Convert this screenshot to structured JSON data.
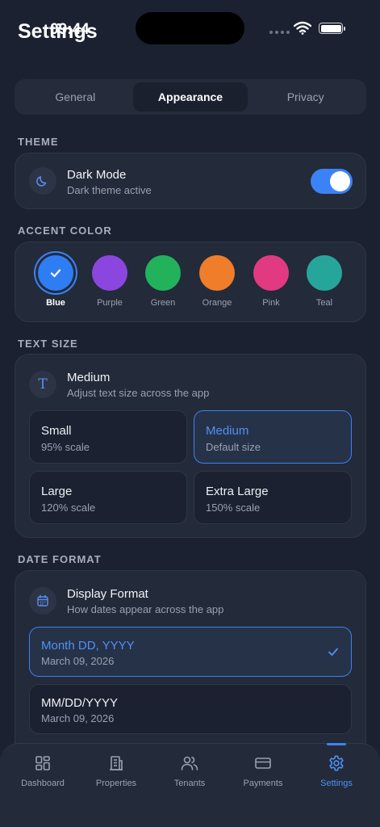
{
  "status": {
    "time": "09:44"
  },
  "header": {
    "title": "Settings"
  },
  "tabs": [
    {
      "label": "General",
      "active": false
    },
    {
      "label": "Appearance",
      "active": true
    },
    {
      "label": "Privacy",
      "active": false
    }
  ],
  "theme": {
    "section_label": "THEME",
    "title": "Dark Mode",
    "subtitle": "Dark theme active",
    "enabled": true
  },
  "accent": {
    "section_label": "ACCENT COLOR",
    "colors": [
      {
        "label": "Blue",
        "hex": "#2f7df3",
        "selected": true
      },
      {
        "label": "Purple",
        "hex": "#8b46e0",
        "selected": false
      },
      {
        "label": "Green",
        "hex": "#22b25c",
        "selected": false
      },
      {
        "label": "Orange",
        "hex": "#f07d2a",
        "selected": false
      },
      {
        "label": "Pink",
        "hex": "#e23a80",
        "selected": false
      },
      {
        "label": "Teal",
        "hex": "#26a69a",
        "selected": false
      }
    ]
  },
  "text_size": {
    "section_label": "TEXT SIZE",
    "title": "Medium",
    "subtitle": "Adjust text size across the app",
    "icon_glyph": "T",
    "options": [
      {
        "title": "Small",
        "sub": "95% scale",
        "selected": false
      },
      {
        "title": "Medium",
        "sub": "Default size",
        "selected": true
      },
      {
        "title": "Large",
        "sub": "120% scale",
        "selected": false
      },
      {
        "title": "Extra Large",
        "sub": "150% scale",
        "selected": false
      }
    ]
  },
  "date_format": {
    "section_label": "DATE FORMAT",
    "title": "Display Format",
    "subtitle": "How dates appear across the app",
    "options": [
      {
        "title": "Month DD, YYYY",
        "sub": "March 09, 2026",
        "selected": true
      },
      {
        "title": "MM/DD/YYYY",
        "sub": "March 09, 2026",
        "selected": false
      }
    ]
  },
  "nav": [
    {
      "label": "Dashboard",
      "icon": "grid-icon",
      "active": false
    },
    {
      "label": "Properties",
      "icon": "building-icon",
      "active": false
    },
    {
      "label": "Tenants",
      "icon": "users-icon",
      "active": false
    },
    {
      "label": "Payments",
      "icon": "card-icon",
      "active": false
    },
    {
      "label": "Settings",
      "icon": "gear-icon",
      "active": true
    }
  ],
  "colors": {
    "accent": "#3b82f6",
    "background": "#1b2130",
    "card": "#232a39"
  }
}
